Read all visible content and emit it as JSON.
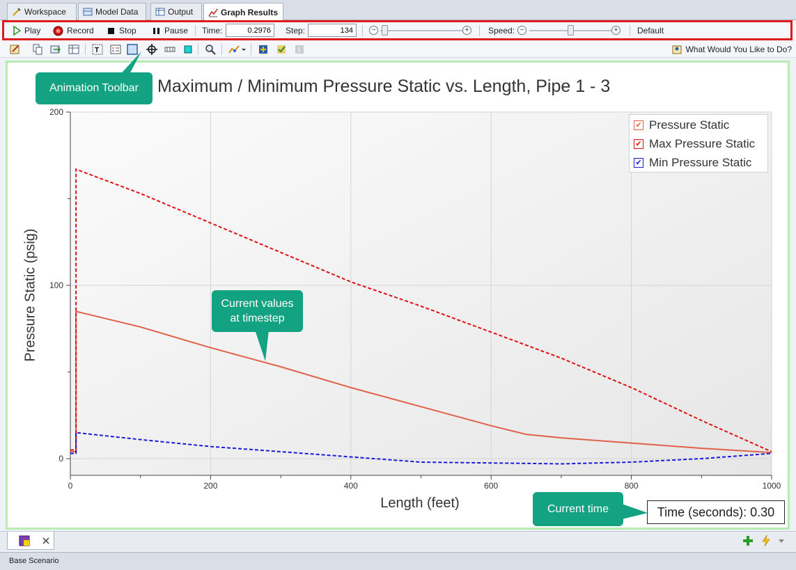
{
  "tabs": [
    {
      "label": "Workspace",
      "icon": "workspace-icon"
    },
    {
      "label": "Model Data",
      "icon": "model-data-icon"
    },
    {
      "label": "Output",
      "icon": "output-icon"
    },
    {
      "label": "Graph Results",
      "icon": "graph-results-icon",
      "active": true
    }
  ],
  "animation_toolbar": {
    "play_label": "Play",
    "record_label": "Record",
    "stop_label": "Stop",
    "pause_label": "Pause",
    "time_label": "Time:",
    "time_value": "0.2976",
    "step_label": "Step:",
    "step_value": "134",
    "speed_label": "Speed:",
    "default_label": "Default",
    "step_slider_level": 0.02,
    "speed_slider_level": 0.5
  },
  "icon_toolbar": {
    "help_label": "What Would You Like to Do?"
  },
  "chart_data": {
    "type": "line",
    "title": "Maximum / Minimum Pressure Static vs. Length, Pipe 1 - 3",
    "xlabel": "Length (feet)",
    "ylabel": "Pressure Static (psig)",
    "xlim": [
      0,
      1000
    ],
    "ylim": [
      -8,
      200
    ],
    "x_ticks": [
      0,
      200,
      400,
      600,
      800,
      1000
    ],
    "y_ticks": [
      0,
      100,
      200
    ],
    "grid": true,
    "legend_position": "top-right",
    "series": [
      {
        "name": "Pressure Static",
        "color": "#e0614a",
        "style": "solid",
        "x": [
          0,
          8,
          8,
          100,
          200,
          300,
          400,
          500,
          600,
          650,
          700,
          800,
          900,
          1000
        ],
        "y": [
          4,
          4,
          85,
          76,
          64,
          53,
          41,
          30,
          19,
          14,
          12,
          9,
          6,
          3.5
        ]
      },
      {
        "name": "Max Pressure Static",
        "color": "#e01010",
        "style": "dashed",
        "x": [
          0,
          8,
          8,
          100,
          200,
          300,
          400,
          500,
          600,
          700,
          800,
          900,
          1000
        ],
        "y": [
          5,
          5,
          167,
          153,
          136,
          119,
          102,
          88,
          73,
          58,
          41,
          22,
          4
        ]
      },
      {
        "name": "Min Pressure Static",
        "color": "#1a1ad6",
        "style": "dashed",
        "x": [
          0,
          8,
          8,
          100,
          200,
          300,
          400,
          500,
          600,
          700,
          800,
          900,
          1000
        ],
        "y": [
          3,
          3,
          15,
          11,
          7,
          4,
          1,
          -2,
          -2.5,
          -3,
          -2,
          0,
          3
        ]
      }
    ]
  },
  "time_readout": "Time (seconds): 0.30",
  "callouts": {
    "animation_toolbar": "Animation Toolbar",
    "current_values": "Current values at timestep",
    "current_time": "Current time"
  },
  "status_bar": {
    "scenario": "Base Scenario"
  },
  "colors": {
    "toolbar_highlight": "#e01b1b",
    "callout": "#13a383",
    "graph_frame": "#b9ecb0"
  }
}
